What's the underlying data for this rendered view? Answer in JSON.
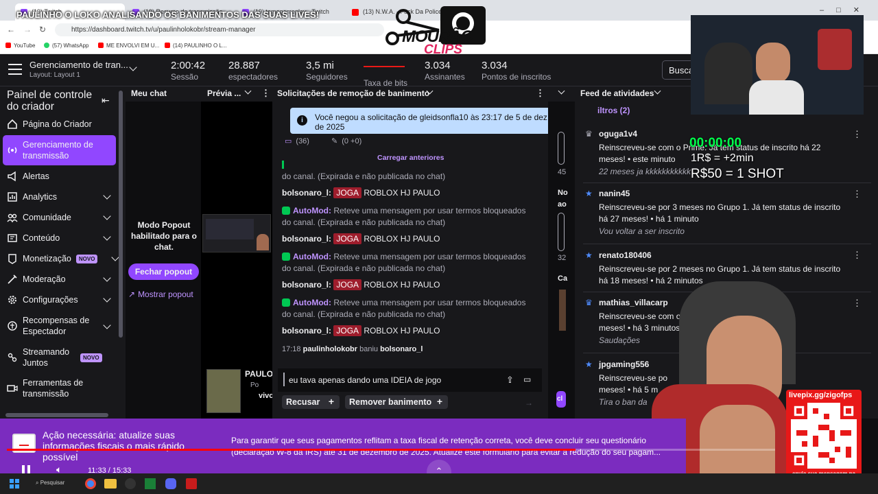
{
  "browser": {
    "tabs": [
      {
        "label": "(19) Twitch",
        "color": "#9147ff"
      },
      {
        "label": "(19) Resumo da transmissão",
        "color": "#9147ff"
      },
      {
        "label": "(19) temogameplay - Twitch",
        "color": "#9147ff"
      },
      {
        "label": "(13) N.W.A. - Fuck Da Police - Yo",
        "color": "#ff0000"
      }
    ],
    "url": "https://dashboard.twitch.tv/u/paulinholokobr/stream-manager",
    "bookmarks": [
      "YouTube",
      "(57) WhatsApp",
      "ME ENVOLVI EM U...",
      "(14) PAULINHO O L..."
    ]
  },
  "overlay": {
    "headline": "PAULINHO O LOKO ANALISANDO OS BANIMENTOS DAS SUAS LIVES!",
    "logo_line1": "MOURÃO",
    "logo_line2": "CLIPS",
    "timer": "00:00:00",
    "promo1": "1R$ = +2min",
    "promo2": "R$50 = 1 SHOT",
    "livepix_url": "livepix.gg/zigofps",
    "livepix_caption": "envie sua mensagem na live via pix!"
  },
  "topbar": {
    "title": "Gerenciamento de tran...",
    "layout": "Layout: Layout 1",
    "stats": [
      {
        "value": "2:00:42",
        "label": "Sessão"
      },
      {
        "value": "28.887",
        "label": "espectadores"
      },
      {
        "value": "3,5 mi",
        "label": "Seguidores"
      },
      {
        "value": "",
        "label": "Taxa de bits"
      },
      {
        "value": "3.034",
        "label": "Assinantes"
      },
      {
        "value": "3.034",
        "label": "Pontos de inscritos"
      }
    ],
    "search_label": "Busca"
  },
  "sidebar": {
    "title": "Painel de controle do criador",
    "items": [
      {
        "label": "Página do Criador"
      },
      {
        "label": "Gerenciamento de transmissão"
      },
      {
        "label": "Alertas"
      },
      {
        "label": "Analytics"
      },
      {
        "label": "Comunidade"
      },
      {
        "label": "Conteúdo"
      },
      {
        "label": "Monetização",
        "badge": "NOVO"
      },
      {
        "label": "Moderação"
      },
      {
        "label": "Configurações"
      },
      {
        "label": "Recompensas de Espectador"
      },
      {
        "label": "Streamando Juntos",
        "badge": "NOVO"
      },
      {
        "label": "Ferramentas de transmissão"
      }
    ]
  },
  "mychat": {
    "header": "Meu chat",
    "popout_text": "Modo Popout habilitado para o chat.",
    "close_popout": "Fechar popout",
    "show_popout": "Mostrar popout"
  },
  "preview": {
    "header": "Prévia ...",
    "channel": "PAULO",
    "sub": "Po",
    "sub2": "vivo"
  },
  "unban": {
    "header": "Solicitações de remoção de banimento",
    "toast": "Você negou a solicitação de gleidsonfla10 às 23:17 de 5 de dez. de 2025",
    "count_msgs": "(36)",
    "count_mod": "(0 +0)",
    "load_previous": "Carregar anteriores",
    "truncated_line": "do canal. (Expirada e não publicada no chat)",
    "automod_name": "AutoMod:",
    "automod_text": "Reteve uma mensagem por usar termos bloqueados do canal. (Expirada e não publicada no chat)",
    "ban_user": "bolsonaro_l:",
    "ban_word": "JOGA",
    "ban_rest": "ROBLOX HJ PAULO",
    "ban_time": "17:18",
    "ban_actor": "paulinholokobr",
    "ban_verb": "baniu",
    "ban_target": "bolsonaro_l",
    "reply_text": "eu tava apenas dando uma IDEIA de jogo",
    "deny": "Recusar",
    "remove_ban": "Remover banimento"
  },
  "midcol": {
    "n1": "45",
    "n2": "No",
    "n3": "ao",
    "n4": "32",
    "n5": "Ca"
  },
  "feed": {
    "header": "Feed de atividades",
    "filters": "iltros (2)",
    "items": [
      {
        "user": "oguga1v4",
        "line1": "Reinscreveu-se com o Prime. Já tem status de inscrito há 22",
        "line2": "meses! • este minuto",
        "sub": "22 meses ja kkkkkkkkkkk"
      },
      {
        "user": "nanin45",
        "line1": "Reinscreveu-se por 3 meses no Grupo 1. Já tem status de inscrito",
        "line2": "há 27 meses! • há 1 minuto",
        "sub": "Vou voltar a ser inscrito"
      },
      {
        "user": "renato180406",
        "line1": "Reinscreveu-se por 2 meses no Grupo 1. Já tem status de inscrito",
        "line2": "há 18 meses! • há 2 minutos",
        "sub": ""
      },
      {
        "user": "mathias_villacarp",
        "line1": "Reinscreveu-se com o Prime. Já tem",
        "line2": "meses! • há 3 minutos",
        "sub": "Saudações"
      },
      {
        "user": "jpgaming556",
        "line1": "Reinscreveu-se po",
        "line2": "meses! • há 5 m",
        "sub": "Tira o ban da"
      }
    ]
  },
  "notice": {
    "title": "Ação necessária: atualize suas informações fiscais o mais rápido possível",
    "body": "Para garantir que seus pagamentos reflitam a taxa fiscal de retenção correta, você deve concluir seu questionário (declaração W-8 da IRS) até 31 de dezembro de 2025. Atualize este formulário para evitar a redução do seu pagam..."
  },
  "player": {
    "time": "11:33 / 15:33",
    "progress": 0.74
  },
  "taskbar": {
    "search": "Pesquisar"
  }
}
